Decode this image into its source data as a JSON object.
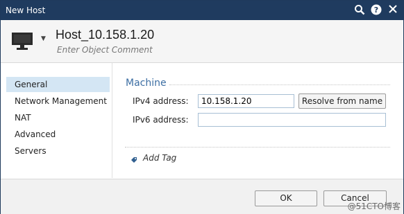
{
  "window": {
    "title": "New Host"
  },
  "header": {
    "name": "Host_10.158.1.20",
    "comment_placeholder": "Enter Object Comment"
  },
  "sidebar": {
    "items": [
      {
        "label": "General",
        "active": true
      },
      {
        "label": "Network Management",
        "active": false
      },
      {
        "label": "NAT",
        "active": false
      },
      {
        "label": "Advanced",
        "active": false
      },
      {
        "label": "Servers",
        "active": false
      }
    ]
  },
  "machine": {
    "section_title": "Machine",
    "ipv4_label": "IPv4 address:",
    "ipv4_value": "10.158.1.20",
    "resolve_label": "Resolve from name",
    "ipv6_label": "IPv6 address:",
    "ipv6_value": ""
  },
  "tags": {
    "add_label": "Add Tag"
  },
  "footer": {
    "ok_label": "OK",
    "cancel_label": "Cancel"
  },
  "watermark": "@51CTO博客",
  "colors": {
    "titlebar": "#1f3b5f",
    "accent": "#3c6ea3",
    "selection": "#d4e6f4"
  }
}
